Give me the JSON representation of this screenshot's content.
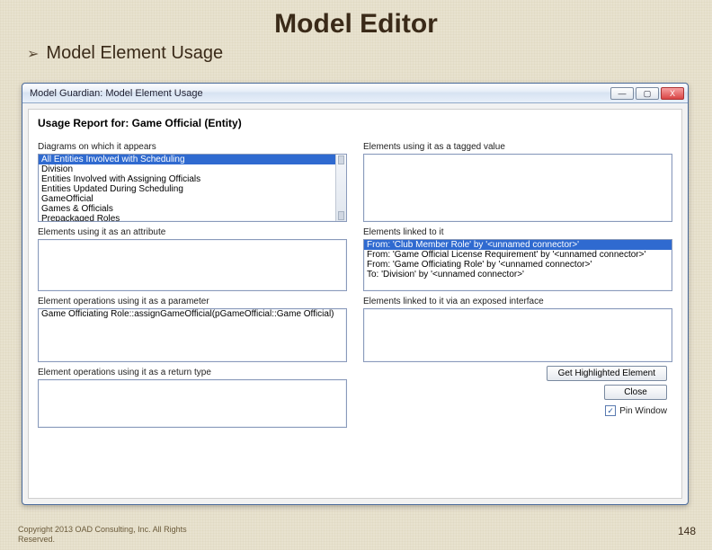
{
  "slide": {
    "title": "Model Editor",
    "bullet": "Model Element Usage"
  },
  "window": {
    "title": "Model Guardian: Model Element Usage",
    "buttons": {
      "min": "—",
      "max": "▢",
      "close": "X"
    }
  },
  "report": {
    "heading": "Usage Report for: Game Official (Entity)"
  },
  "left": {
    "diagrams": {
      "label": "Diagrams on which it appears",
      "items": [
        "All Entities Involved with Scheduling",
        "Division",
        "Entities Involved with Assigning Officials",
        "Entities Updated During Scheduling",
        "GameOfficial",
        "Games & Officials",
        "Prepackaged Roles"
      ],
      "selected": 0
    },
    "attr": {
      "label": "Elements using it as an attribute"
    },
    "param": {
      "label": "Element operations using it as a parameter",
      "items": [
        "Game Officiating Role::assignGameOfficial(pGameOfficial::Game Official)"
      ]
    },
    "ret": {
      "label": "Element operations using it as a return type"
    }
  },
  "right": {
    "tagged": {
      "label": "Elements using it as a tagged value"
    },
    "linked": {
      "label": "Elements linked to it",
      "items": [
        "From: 'Club Member Role' by '<unnamed connector>'",
        "From: 'Game Official License Requirement' by '<unnamed connector>'",
        "From: 'Game Officiating Role' by '<unnamed connector>'",
        "To:   'Division' by '<unnamed connector>'"
      ],
      "selected": 0
    },
    "exposed": {
      "label": "Elements linked to it via an exposed interface"
    }
  },
  "actions": {
    "get": "Get Highlighted Element",
    "close": "Close",
    "pin": "Pin Window",
    "pinned": "✓"
  },
  "footer": {
    "copyright_l1": "Copyright 2013 OAD Consulting, Inc.  All Rights",
    "copyright_l2": "Reserved.",
    "page": "148"
  }
}
